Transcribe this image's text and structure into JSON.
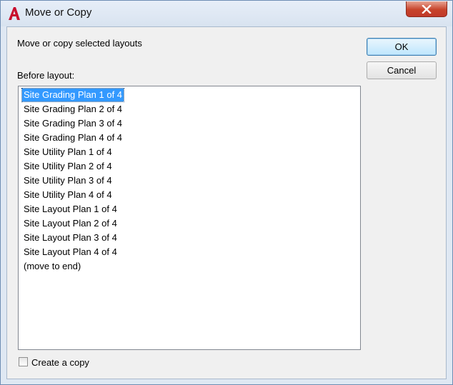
{
  "window": {
    "title": "Move or Copy"
  },
  "dialog": {
    "prompt": "Move or copy selected layouts",
    "before_layout_label": "Before layout:",
    "ok_label": "OK",
    "cancel_label": "Cancel",
    "copy_checkbox_label": "Create a copy",
    "copy_checked": false
  },
  "layouts": [
    {
      "label": "Site Grading Plan 1 of 4",
      "selected": true
    },
    {
      "label": "Site Grading Plan 2 of 4",
      "selected": false
    },
    {
      "label": "Site Grading Plan 3 of 4",
      "selected": false
    },
    {
      "label": "Site Grading Plan 4 of 4",
      "selected": false
    },
    {
      "label": "Site Utility Plan 1 of 4",
      "selected": false
    },
    {
      "label": "Site Utility Plan 2 of 4",
      "selected": false
    },
    {
      "label": "Site Utility Plan 3 of 4",
      "selected": false
    },
    {
      "label": "Site Utility Plan 4 of 4",
      "selected": false
    },
    {
      "label": "Site Layout Plan 1 of 4",
      "selected": false
    },
    {
      "label": "Site Layout Plan 2 of 4",
      "selected": false
    },
    {
      "label": "Site Layout Plan 3 of 4",
      "selected": false
    },
    {
      "label": "Site Layout Plan 4 of 4",
      "selected": false
    },
    {
      "label": "(move to end)",
      "selected": false
    }
  ],
  "colors": {
    "selection": "#3399ff",
    "close_button": "#c7432b",
    "app_icon": "#c8102e"
  },
  "icons": {
    "app": "autocad-a-icon",
    "close": "close-x-icon"
  }
}
